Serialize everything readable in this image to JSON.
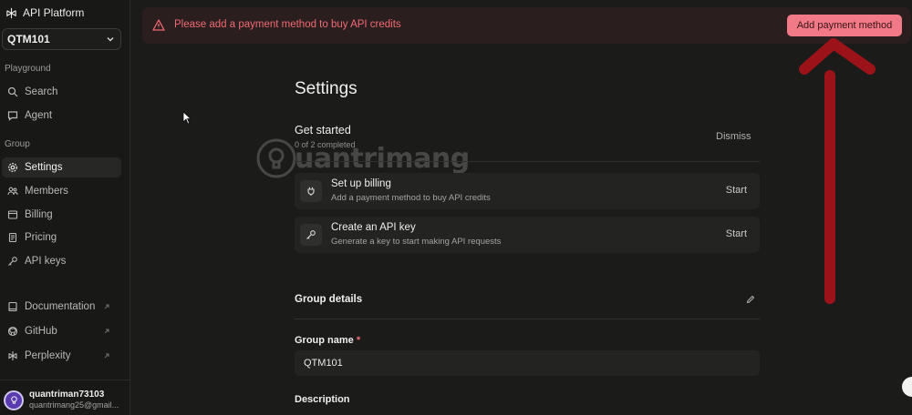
{
  "sidebar": {
    "brand": "API Platform",
    "org": "QTM101",
    "sections": {
      "playground": "Playground",
      "group": "Group"
    },
    "playground_items": [
      {
        "label": "Search",
        "icon": "search-icon"
      },
      {
        "label": "Agent",
        "icon": "chat-icon"
      }
    ],
    "group_items": [
      {
        "label": "Settings",
        "icon": "gear-icon"
      },
      {
        "label": "Members",
        "icon": "members-icon"
      },
      {
        "label": "Billing",
        "icon": "card-icon"
      },
      {
        "label": "Pricing",
        "icon": "document-icon"
      },
      {
        "label": "API keys",
        "icon": "key-icon"
      }
    ],
    "external_items": [
      {
        "label": "Documentation",
        "icon": "book-icon"
      },
      {
        "label": "GitHub",
        "icon": "github-icon"
      },
      {
        "label": "Perplexity",
        "icon": "perplexity-icon"
      }
    ],
    "user": {
      "name": "quantriman73103",
      "email": "quantrimang25@gmail..."
    }
  },
  "banner": {
    "message": "Please add a payment method to buy API credits",
    "button": "Add payment method",
    "color": "#f06a73"
  },
  "main": {
    "title": "Settings",
    "get_started": {
      "title": "Get started",
      "progress": "0 of 2 completed",
      "dismiss": "Dismiss",
      "tasks": [
        {
          "title": "Set up billing",
          "desc": "Add a payment method to buy API credits",
          "action": "Start"
        },
        {
          "title": "Create an API key",
          "desc": "Generate a key to start making API requests",
          "action": "Start"
        }
      ]
    },
    "group_details": {
      "title": "Group details",
      "name_label": "Group name",
      "required_mark": "*",
      "name_value": "QTM101",
      "description_label": "Description"
    }
  },
  "watermark": "uantrimang",
  "colors": {
    "accent": "#f27a86",
    "arrow": "#9b1319",
    "background": "#1b1b1a"
  }
}
